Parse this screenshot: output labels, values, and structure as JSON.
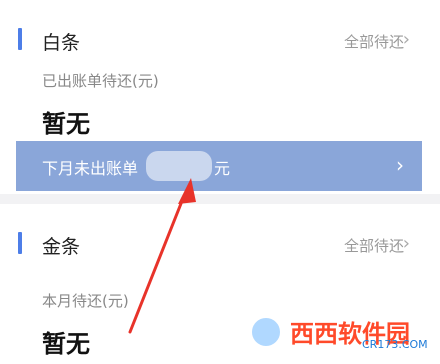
{
  "baitiao": {
    "title": "白条",
    "all_pending": "全部待还",
    "chevron": "›",
    "billed_label": "已出账单待还(元)",
    "billed_value": "暂无",
    "next_month": {
      "prefix": "下月未出账单",
      "suffix": "元",
      "chevron": "›"
    }
  },
  "jintiao": {
    "title": "金条",
    "all_pending": "全部待还",
    "chevron": "›",
    "month_label": "本月待还(元)",
    "month_value": "暂无"
  },
  "colors": {
    "accent": "#4d7ee8",
    "bar": "#8aa6d9",
    "annotation_arrow": "#e8332a"
  },
  "watermark": {
    "brand": "西西软件园",
    "site": "CR173.COM"
  }
}
